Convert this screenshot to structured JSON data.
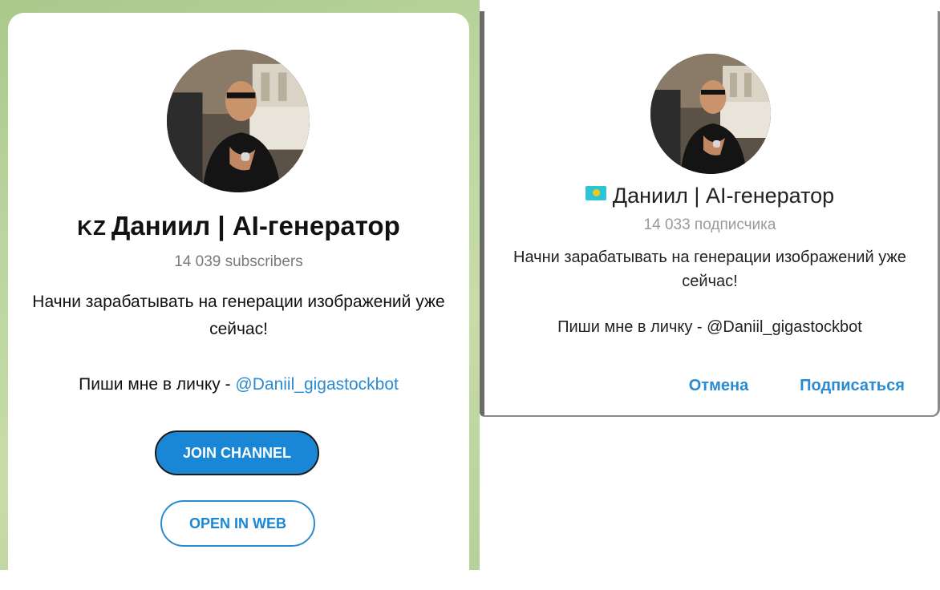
{
  "web_preview": {
    "avatar_alt": "avatar",
    "flag_text": "KZ",
    "title": "Даниил | AI-генератор",
    "subscribers": "14 039 subscribers",
    "description": "Начни зарабатывать на генерации изображений уже сейчас!",
    "contact_prefix": "Пиши мне в личку - ",
    "contact_link": "@Daniil_gigastockbot",
    "join_button": "JOIN CHANNEL",
    "open_web_button": "OPEN IN WEB"
  },
  "desktop_dialog": {
    "flag_icon": "kazakhstan-flag-icon",
    "title": "Даниил | AI-генератор",
    "subscribers": "14 033 подписчика",
    "description": "Начни зарабатывать на генерации изображений уже сейчас!",
    "contact": "Пиши мне в личку - @Daniil_gigastockbot",
    "cancel_button": "Отмена",
    "subscribe_button": "Подписаться"
  },
  "colors": {
    "accent": "#1a86d6",
    "link": "#2a8ad2",
    "subtitle": "#7a7a7a"
  }
}
